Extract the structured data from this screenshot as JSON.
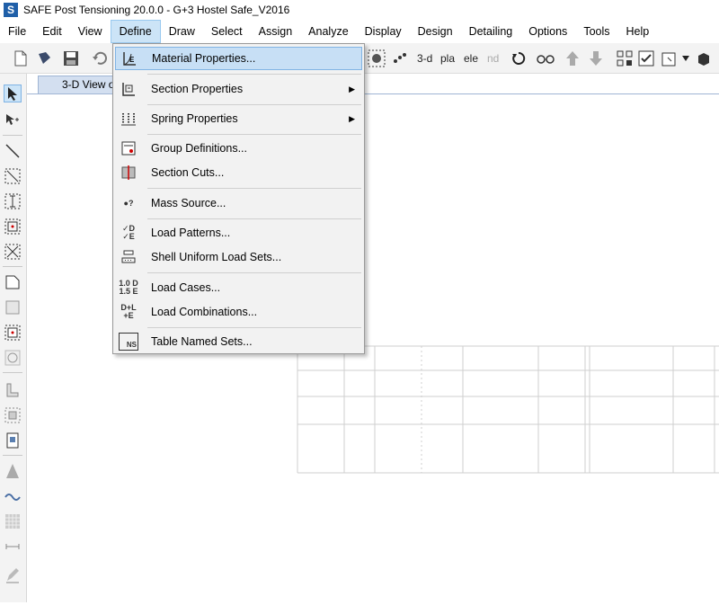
{
  "window": {
    "title": "SAFE Post Tensioning 20.0.0 - G+3 Hostel Safe_V2016",
    "app_icon_letter": "S"
  },
  "menubar": {
    "items": [
      "File",
      "Edit",
      "View",
      "Define",
      "Draw",
      "Select",
      "Assign",
      "Analyze",
      "Display",
      "Design",
      "Detailing",
      "Options",
      "Tools",
      "Help"
    ],
    "active": "Define"
  },
  "toolbar": {
    "text_buttons": [
      "3-d",
      "pla",
      "ele",
      "nd"
    ]
  },
  "tab": {
    "label": "3-D View o"
  },
  "define_menu": {
    "items": [
      {
        "label": "Material Properties...",
        "icon": "material-properties-icon",
        "glyph": "E",
        "highlighted": true
      },
      {
        "label": "Section Properties",
        "icon": "section-properties-icon",
        "glyph": "",
        "submenu": true
      },
      {
        "label": "Spring Properties",
        "icon": "spring-properties-icon",
        "glyph": "",
        "submenu": true
      },
      {
        "label": "Group Definitions...",
        "icon": "group-definitions-icon",
        "glyph": ""
      },
      {
        "label": "Section Cuts...",
        "icon": "section-cuts-icon",
        "glyph": ""
      },
      {
        "label": "Mass Source...",
        "icon": "mass-source-icon",
        "glyph": "●?"
      },
      {
        "label": "Load Patterns...",
        "icon": "load-patterns-icon",
        "glyph": "✓D ✓E"
      },
      {
        "label": "Shell Uniform Load Sets...",
        "icon": "shell-load-sets-icon",
        "glyph": ""
      },
      {
        "label": "Load Cases...",
        "icon": "load-cases-icon",
        "glyph": "1.0 D 1.5 E"
      },
      {
        "label": "Load Combinations...",
        "icon": "load-combinations-icon",
        "glyph": "D+L +E"
      },
      {
        "label": "Table Named Sets...",
        "icon": "table-named-sets-icon",
        "glyph": "NS"
      }
    ],
    "submenu_arrow": "▶"
  },
  "colors": {
    "menu_highlight": "#c7dff5",
    "grid_line": "#cfcfcf",
    "app_icon": "#1f5fa8"
  }
}
